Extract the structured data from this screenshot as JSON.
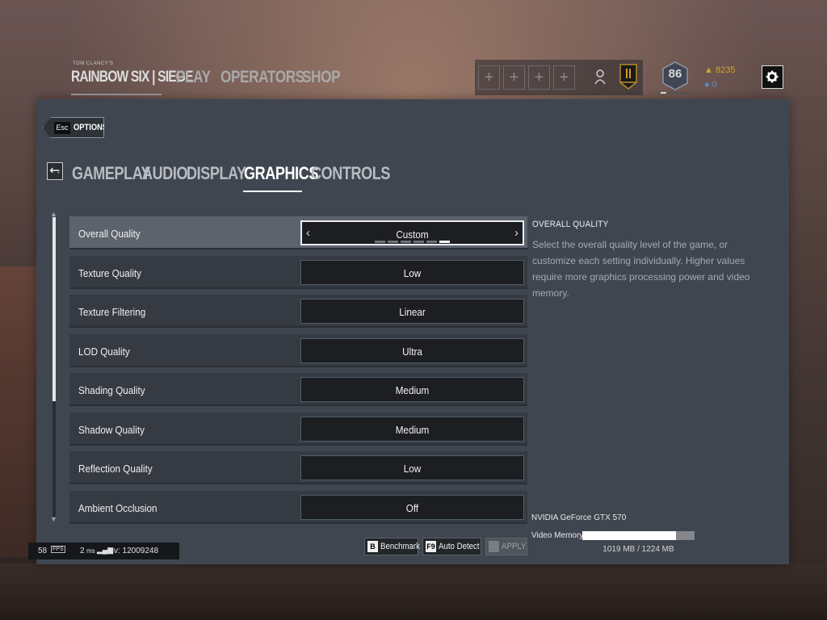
{
  "header": {
    "logo_small": "TOM CLANCY'S",
    "logo_main": "RAINBOW SIX | SIEGE",
    "nav": [
      "PLAY",
      "OPERATORS",
      "SHOP"
    ],
    "level": "86",
    "level_progress": 0.18,
    "renown": "8235",
    "r6_credits": "0"
  },
  "options": {
    "esc_key": "Esc",
    "label": "OPTIONS"
  },
  "tabs": [
    {
      "label": "GAMEPLAY",
      "active": false
    },
    {
      "label": "AUDIO",
      "active": false
    },
    {
      "label": "DISPLAY",
      "active": false
    },
    {
      "label": "GRAPHICS",
      "active": true
    },
    {
      "label": "CONTROLS",
      "active": false
    }
  ],
  "settings": [
    {
      "label": "Overall Quality",
      "value": "Custom"
    },
    {
      "label": "Texture Quality",
      "value": "Low"
    },
    {
      "label": "Texture Filtering",
      "value": "Linear"
    },
    {
      "label": "LOD Quality",
      "value": "Ultra"
    },
    {
      "label": "Shading Quality",
      "value": "Medium"
    },
    {
      "label": "Shadow Quality",
      "value": "Medium"
    },
    {
      "label": "Reflection Quality",
      "value": "Low"
    },
    {
      "label": "Ambient Occlusion",
      "value": "Off"
    }
  ],
  "description": {
    "title": "OVERALL QUALITY",
    "body": "Select the overall quality level of the game, or customize each setting individually. Higher values require more graphics processing power and video memory."
  },
  "gpu": {
    "name": "NVIDIA GeForce GTX 570",
    "vram_label": "Video Memory:",
    "vram_text": "1019 MB / 1224 MB",
    "vram_used_fraction": 0.832
  },
  "buttons": {
    "benchmark_key": "B",
    "benchmark": "Benchmark",
    "autodetect_key": "F9",
    "autodetect": "Auto Detect",
    "apply_key": "_",
    "apply": "APPLY"
  },
  "perf": {
    "fps": "58",
    "fps_unit": "FPS",
    "ping": "2",
    "ping_unit": "ms",
    "version": "v: 12009248"
  },
  "icons": {
    "gear": "gear-icon",
    "back": "back-icon",
    "squad_add": "plus-icon",
    "person": "person-icon",
    "banner": "banner-icon",
    "renown": "renown-icon",
    "credits": "r6-credits-icon"
  }
}
